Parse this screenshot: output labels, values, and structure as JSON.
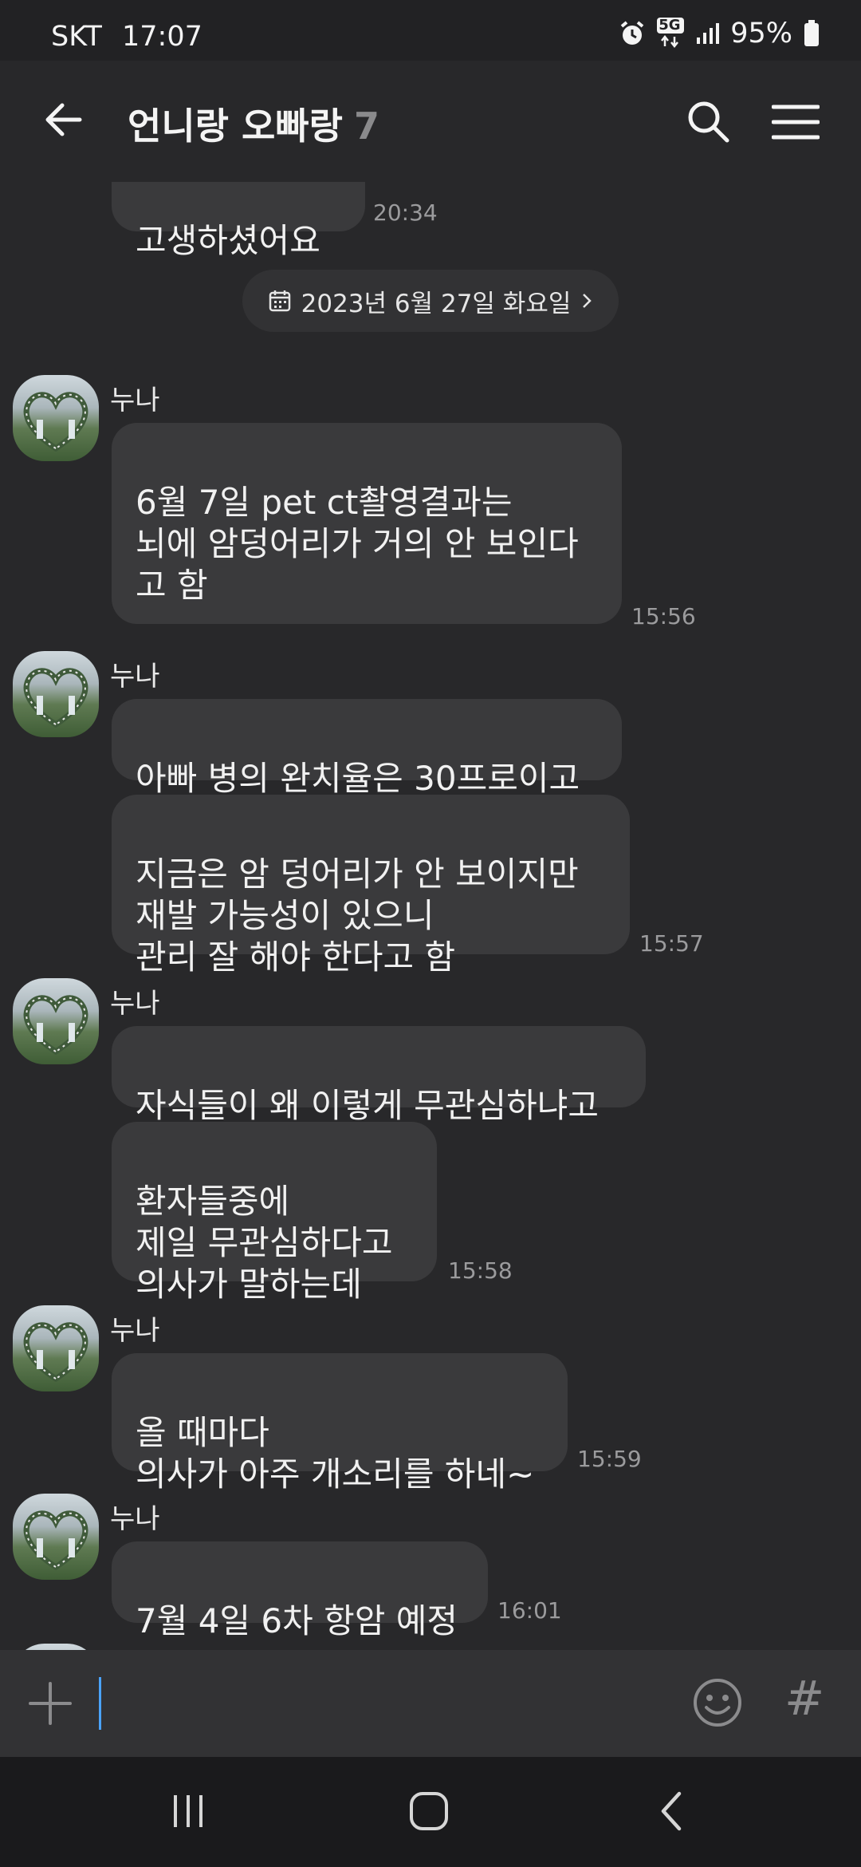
{
  "status_bar": {
    "carrier": "SKT",
    "time": "17:07",
    "network": "5G",
    "battery": "95%"
  },
  "header": {
    "title": "언니랑 오빠랑",
    "member_count": "7"
  },
  "chat": {
    "partial_message": "고생하셨어요",
    "partial_time": "20:34",
    "date_divider": "2023년 6월 27일 화요일",
    "groups": [
      {
        "sender": "누나",
        "messages": [
          {
            "text": "6월 7일 pet  ct촬영결과는\n뇌에 암덩어리가 거의 안 보인다\n고 함\n ",
            "time": "15:56"
          }
        ]
      },
      {
        "sender": "누나",
        "messages": [
          {
            "text": "아빠 병의 완치율은 30프로이고",
            "time": ""
          },
          {
            "text": "지금은 암 덩어리가 안 보이지만\n재발 가능성이 있으니\n관리 잘 해야 한다고 함",
            "time": "15:57"
          }
        ]
      },
      {
        "sender": "누나",
        "messages": [
          {
            "text": "자식들이 왜 이렇게 무관심하냐고",
            "time": ""
          },
          {
            "text": "환자들중에\n제일 무관심하다고\n의사가 말하는데",
            "time": "15:58"
          }
        ]
      },
      {
        "sender": "누나",
        "messages": [
          {
            "text": "올 때마다\n의사가 아주 개소리를 하네~",
            "time": "15:59"
          }
        ]
      },
      {
        "sender": "누나",
        "messages": [
          {
            "text": "7월 4일 6차 항암 예정",
            "time": "16:01"
          }
        ]
      }
    ]
  },
  "input": {
    "placeholder": ""
  },
  "icons": {
    "back": "arrow-left-icon",
    "search": "search-icon",
    "menu": "hamburger-menu-icon",
    "attach": "plus-icon",
    "emoji": "emoji-icon",
    "hashtag": "hashtag-icon",
    "calendar": "calendar-icon"
  },
  "colors": {
    "background": "#28282a",
    "bubble": "#3a3a3c",
    "accent_cursor": "#4aa3ff"
  }
}
